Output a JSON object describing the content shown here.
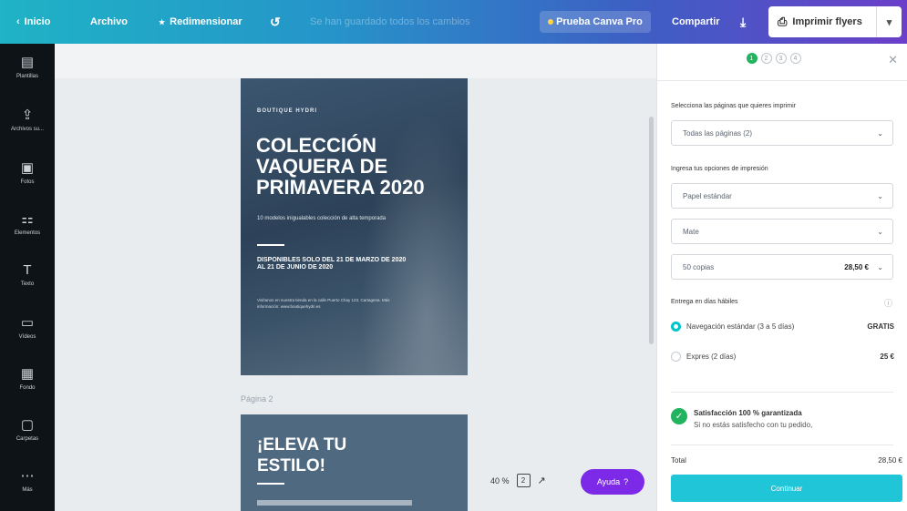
{
  "topbar": {
    "home": "Inicio",
    "file": "Archivo",
    "resize": "Redimensionar",
    "undo_icon": "undo-icon",
    "saved_status": "Se han guardado todos los cambios",
    "try_pro": "Prueba Canva Pro",
    "share": "Compartir",
    "download_icon": "download-icon",
    "print_label": "Imprimir flyers"
  },
  "sidebar": {
    "items": [
      {
        "label": "Plantillas",
        "icon": "templates-icon",
        "glyph": "▤"
      },
      {
        "label": "Archivos su...",
        "icon": "upload-icon",
        "glyph": "⇪"
      },
      {
        "label": "Fotos",
        "icon": "photos-icon",
        "glyph": "▣"
      },
      {
        "label": "Elementos",
        "icon": "elements-icon",
        "glyph": "⚏"
      },
      {
        "label": "Texto",
        "icon": "text-icon",
        "glyph": "T"
      },
      {
        "label": "Vídeos",
        "icon": "videos-icon",
        "glyph": "▭"
      },
      {
        "label": "Fondo",
        "icon": "background-icon",
        "glyph": "▦"
      },
      {
        "label": "Carpetas",
        "icon": "folder-icon",
        "glyph": "▢"
      },
      {
        "label": "Más",
        "icon": "more-icon",
        "glyph": "⋯"
      }
    ]
  },
  "canvas": {
    "page1": {
      "brand": "BOUTIQUE HYDRI",
      "title": "COLECCIÓN VAQUERA DE PRIMAVERA 2020",
      "subtitle": "10 modelos inigualables colección de alta temporada",
      "availability": "DISPONIBLES SOLO DEL 21 DE MARZO DE 2020 AL 21 DE JUNIO DE 2020",
      "small_text": "Visítanos en nuestra tienda en la calle Puerto Chay 123, Cartagena. Más información: www.boutiquehydri.es"
    },
    "page2_label": "Página 2",
    "page2": {
      "title": "¡ELEVA TU ESTILO!"
    },
    "zoom": "40 %",
    "page_count": "2",
    "help": "Ayuda"
  },
  "panel": {
    "steps": [
      "1",
      "2",
      "3",
      "4"
    ],
    "select_pages_label": "Selecciona las páginas que quieres imprimir",
    "pages_value": "Todas las páginas (2)",
    "print_options_label": "Ingresa tus opciones de impresión",
    "paper_value": "Papel estándar",
    "finish_value": "Mate",
    "copies_value": "50 copias",
    "copies_price": "28,50 €",
    "delivery_label": "Entrega en días hábiles",
    "shipping": [
      {
        "label": "Navegación estándar (3 a 5 días)",
        "price": "GRATIS",
        "selected": true
      },
      {
        "label": "Expres (2 días)",
        "price": "25 €",
        "selected": false
      }
    ],
    "satisfaction_title": "Satisfacción 100 % garantizada",
    "satisfaction_text": "Si no estás satisfecho con tu pedido,",
    "total_label": "Total",
    "total_value": "28,50 €",
    "continue": "Continuar"
  }
}
